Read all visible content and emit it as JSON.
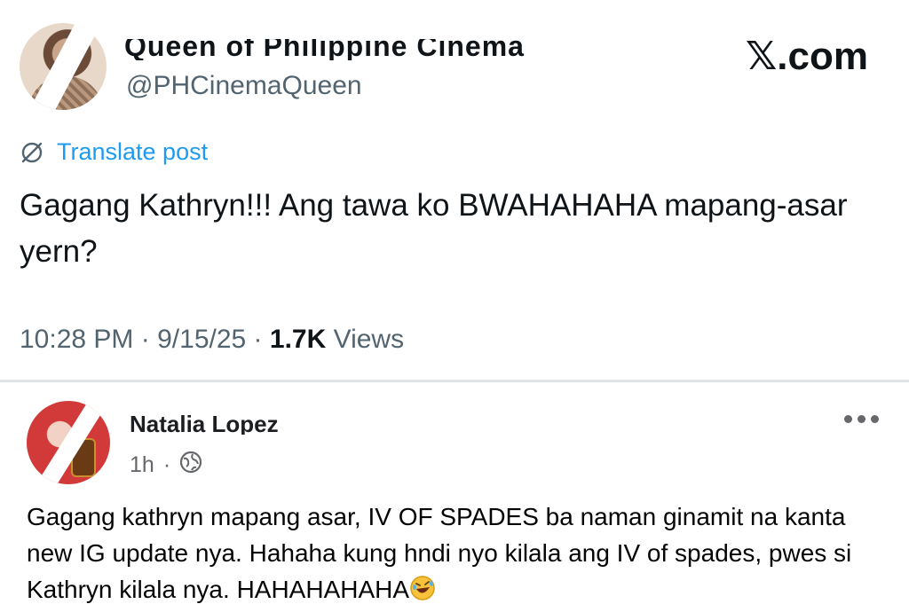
{
  "tweet": {
    "display_name": "Queen of Philippine Cinema",
    "handle": "@PHCinemaQueen",
    "brand": "𝕏.com",
    "translate_label": "Translate post",
    "text": "Gagang Kathryn!!! Ang tawa ko BWAHAHAHA mapang-asar yern?",
    "time": "10:28 PM",
    "date": "9/15/25",
    "views_count": "1.7K",
    "views_label": "Views",
    "separator": "·"
  },
  "comment": {
    "author": "Natalia Lopez",
    "age": "1h",
    "separator": "·",
    "audience_icon": "globe-icon",
    "text": "Gagang kathryn mapang asar, IV OF SPADES ba naman ginamit na kanta new IG update nya. Hahaha kung hndi nyo kilala ang IV of spades, pwes si Kathryn kilala nya. HAHAHAHAHA",
    "emoji": "🤣"
  },
  "colors": {
    "link_blue": "#1d9bf0",
    "muted_gray": "#536471",
    "text_dark": "#0f1419"
  }
}
